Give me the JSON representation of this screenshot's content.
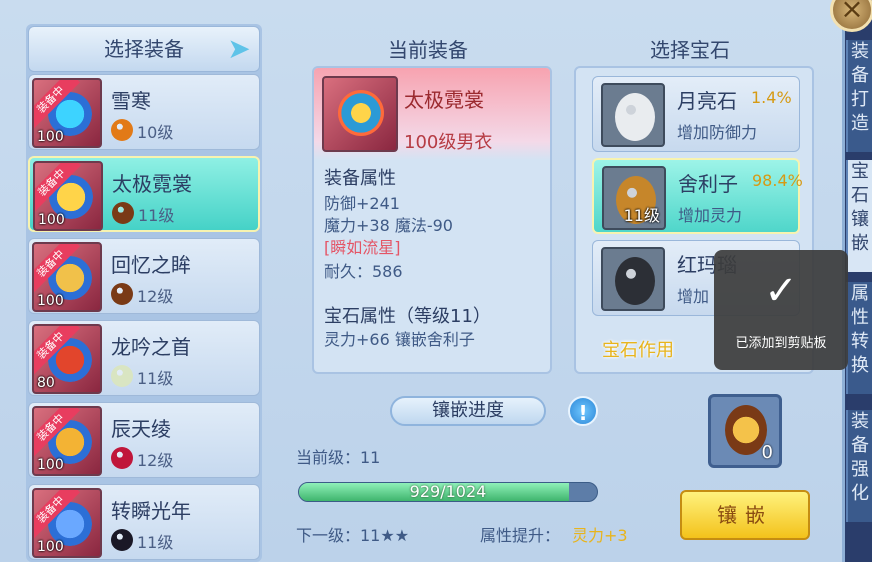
{
  "close_icon": "close-x-icon",
  "left": {
    "title": "选择装备",
    "items": [
      {
        "tag": "装备中",
        "level": "100",
        "name": "雪寒",
        "gem_level": "10级",
        "gem_color": "#e27a17",
        "art": "#3dd3ff"
      },
      {
        "tag": "装备中",
        "level": "100",
        "name": "太极霓裳",
        "gem_level": "11级",
        "gem_color": "#7a3a16",
        "art": "#ffd449"
      },
      {
        "tag": "装备中",
        "level": "100",
        "name": "回忆之眸",
        "gem_level": "12级",
        "gem_color": "#7a3a16",
        "art": "#f1c14a"
      },
      {
        "tag": "装备中",
        "level": "80",
        "name": "龙吟之首",
        "gem_level": "11级",
        "gem_color": "#d9e5c2",
        "art": "#e2452c"
      },
      {
        "tag": "装备中",
        "level": "100",
        "name": "辰天绫",
        "gem_level": "12级",
        "gem_color": "#c0163a",
        "art": "#f3b334"
      },
      {
        "tag": "装备中",
        "level": "100",
        "name": "转瞬光年",
        "gem_level": "11级",
        "gem_color": "#1a1826",
        "art": "#6aa8ff"
      }
    ]
  },
  "middle": {
    "title": "当前装备",
    "name": "太极霓裳",
    "sub": "100级男衣",
    "attr_header": "装备属性",
    "attrs": [
      "防御+241",
      "魔力+38 魔法-90"
    ],
    "special": "[瞬如流星]",
    "durability": "耐久：586",
    "gem_header": "宝石属性（等级11）",
    "gem_attr": "灵力+66 镶嵌舍利子"
  },
  "right": {
    "title": "选择宝石",
    "gems": [
      {
        "name": "月亮石",
        "rate": "1.4%",
        "effect": "增加防御力",
        "count": "",
        "stone": "#e9ecef"
      },
      {
        "name": "舍利子",
        "rate": "98.4%",
        "effect": "增加灵力",
        "count": "11级",
        "stone": "#c6862a"
      },
      {
        "name": "红玛瑙",
        "rate": "",
        "effect": "增加",
        "count": "",
        "stone": "#2c2f36"
      }
    ],
    "func_label": "宝石作用"
  },
  "progress": {
    "title": "镶嵌进度",
    "current_level": "当前级：11",
    "bar_text": "929/1024",
    "fraction": 0.907,
    "next_level": "下一级：11★★",
    "gain_label": "属性提升：",
    "gain_value": "灵力+3"
  },
  "target_gem_count": "0",
  "inlay_button": "镶嵌",
  "side_tabs": [
    "装备打造",
    "宝石镶嵌",
    "属性转换",
    "装备强化"
  ],
  "toast": {
    "check": "✓",
    "message": "已添加到剪贴板"
  }
}
